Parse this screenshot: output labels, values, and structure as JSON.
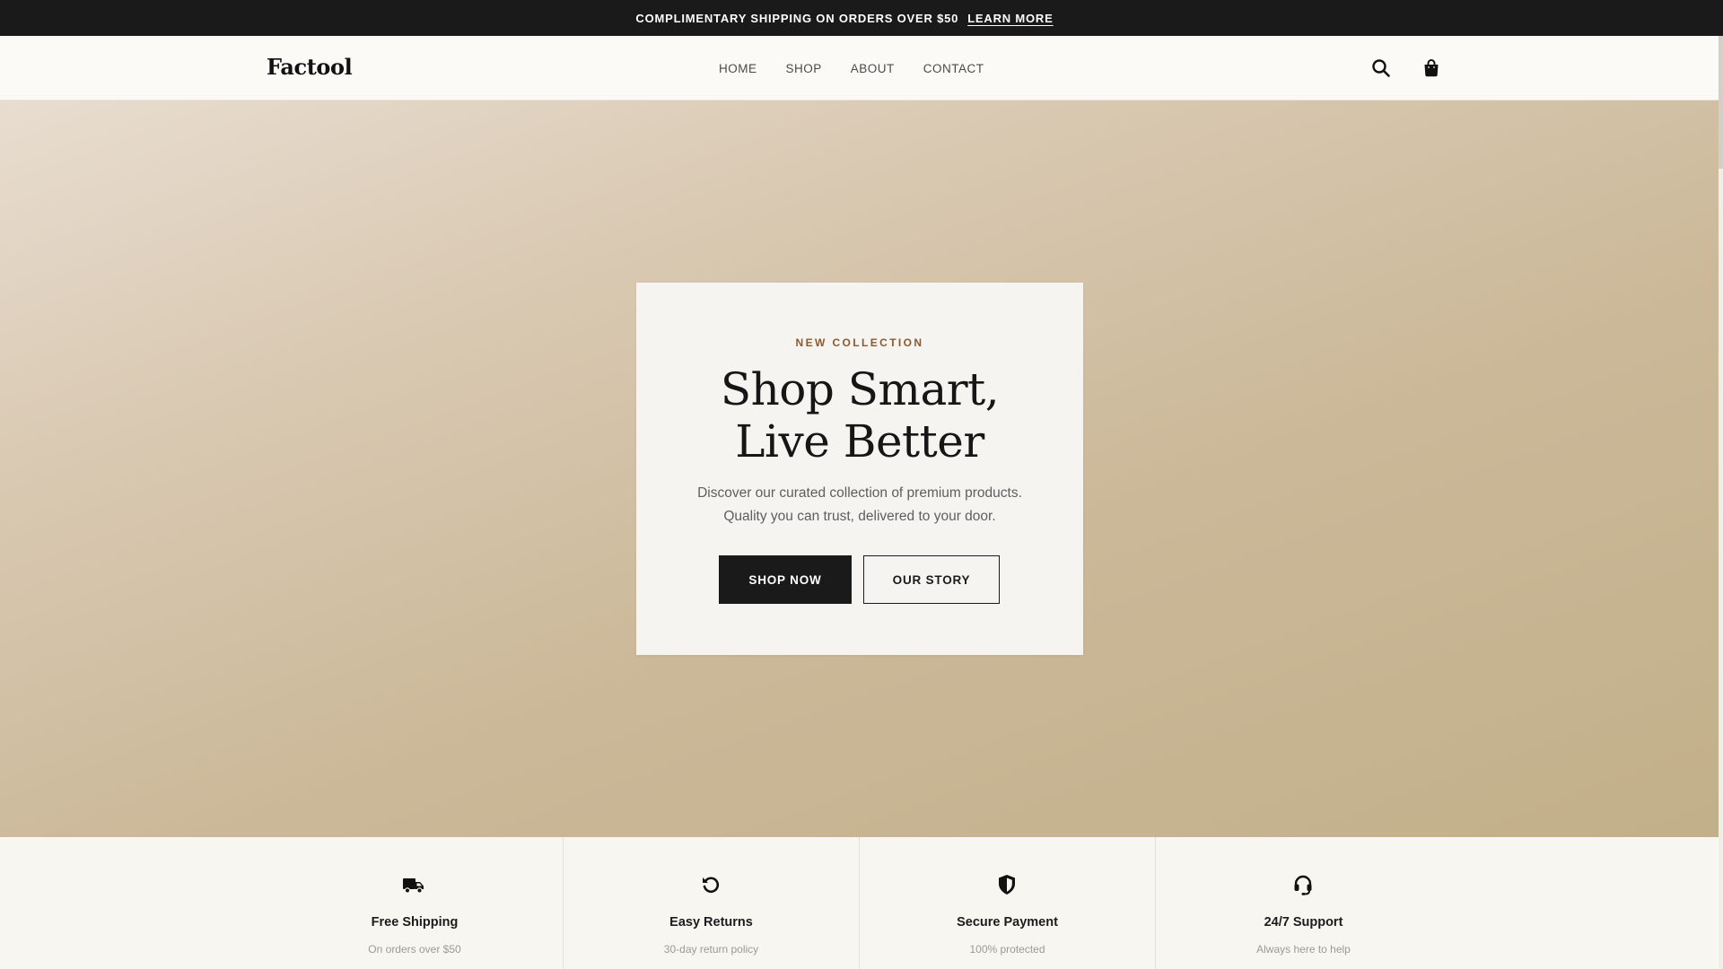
{
  "announcement": {
    "text": "COMPLIMENTARY SHIPPING ON ORDERS OVER $50",
    "link_label": "LEARN MORE"
  },
  "header": {
    "logo": "Factool",
    "nav": [
      {
        "label": "HOME"
      },
      {
        "label": "SHOP"
      },
      {
        "label": "ABOUT"
      },
      {
        "label": "CONTACT"
      }
    ],
    "icons": [
      "search-icon",
      "shopping-bag-icon"
    ]
  },
  "hero": {
    "eyebrow": "NEW COLLECTION",
    "title_line1": "Shop Smart,",
    "title_line2": "Live Better",
    "subtitle_line1": "Discover our curated collection of premium products.",
    "subtitle_line2": "Quality you can trust, delivered to your door.",
    "primary_button": "SHOP NOW",
    "secondary_button": "OUR STORY"
  },
  "features": [
    {
      "icon": "truck-icon",
      "title": "Free Shipping",
      "desc": "On orders over $50"
    },
    {
      "icon": "return-icon",
      "title": "Easy Returns",
      "desc": "30-day return policy"
    },
    {
      "icon": "shield-icon",
      "title": "Secure Payment",
      "desc": "100% protected"
    },
    {
      "icon": "headset-icon",
      "title": "24/7 Support",
      "desc": "Always here to help"
    }
  ],
  "colors": {
    "announcement_bg": "#1a1a1a",
    "accent": "#8a5a2e",
    "hero_bg_light": "#e8ddd0",
    "hero_bg_dark": "#c2b08a",
    "button_dark": "#1a1a1a"
  }
}
